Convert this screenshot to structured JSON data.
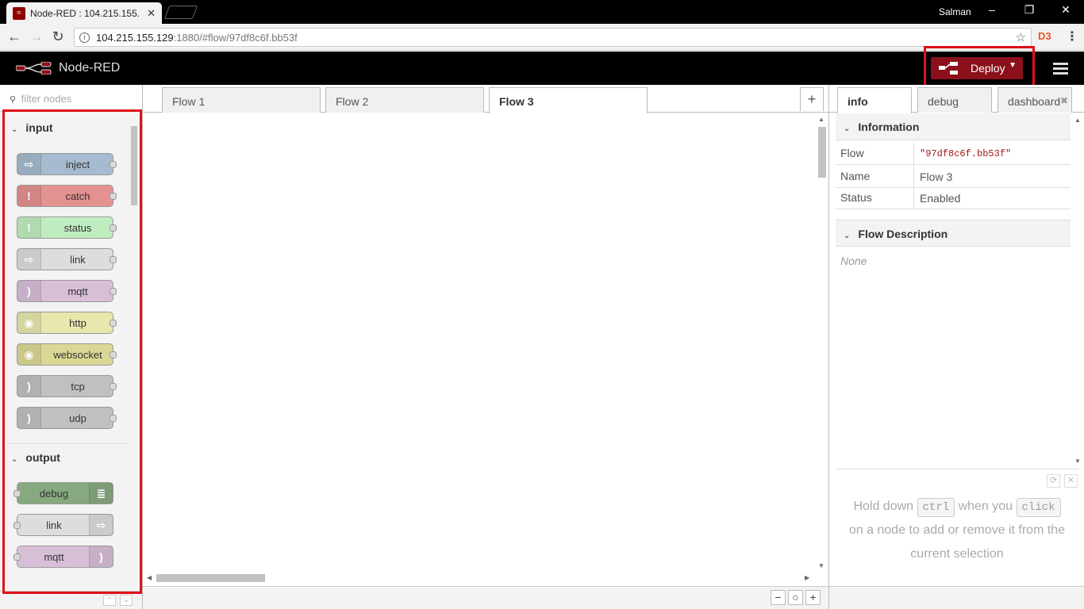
{
  "browser": {
    "tab_title": "Node-RED : 104.215.155.",
    "tab_close": "✕",
    "user": "Salman",
    "url_host": "104.215.155.129",
    "url_path": ":1880/#flow/97df8c6f.bb53f",
    "info_glyph": "i",
    "star_glyph": "☆",
    "ext_glyph": "D3",
    "menu_glyph": "⋮",
    "back_glyph": "←",
    "forward_glyph": "→",
    "reload_glyph": "↻",
    "minimize_glyph": "–",
    "restore_glyph": "❐",
    "close_glyph": "✕"
  },
  "header": {
    "title": "Node-RED",
    "deploy_label": "Deploy",
    "deploy_caret": "▼",
    "brand_color": "#8c101c"
  },
  "palette": {
    "filter_placeholder": "filter nodes",
    "filter_icon": "⚲",
    "categories": [
      {
        "name": "input",
        "chevron": "⌄",
        "nodes": [
          {
            "label": "inject",
            "color": "#a6bbcf",
            "icon": "arrow-in-icon",
            "glyph": "⇨"
          },
          {
            "label": "catch",
            "color": "#e49191",
            "icon": "alert-icon",
            "glyph": "!"
          },
          {
            "label": "status",
            "color": "#c0edc0",
            "icon": "alert-icon",
            "glyph": "!"
          },
          {
            "label": "link",
            "color": "#dddddd",
            "icon": "link-in-icon",
            "glyph": "⇨"
          },
          {
            "label": "mqtt",
            "color": "#d8bfd8",
            "icon": "bridge-icon",
            "glyph": ")"
          },
          {
            "label": "http",
            "color": "#e7e7ae",
            "icon": "globe-icon",
            "glyph": "◉"
          },
          {
            "label": "websocket",
            "color": "#dbd896",
            "icon": "globe-icon",
            "glyph": "◉"
          },
          {
            "label": "tcp",
            "color": "#c0c0c0",
            "icon": "bridge-icon",
            "glyph": ")"
          },
          {
            "label": "udp",
            "color": "#c0c0c0",
            "icon": "bridge-icon",
            "glyph": ")"
          }
        ]
      },
      {
        "name": "output",
        "chevron": "⌄",
        "nodes": [
          {
            "label": "debug",
            "color": "#87a980",
            "icon": "debug-list-icon",
            "glyph": "≣"
          },
          {
            "label": "link",
            "color": "#dddddd",
            "icon": "link-out-icon",
            "glyph": "⇨"
          },
          {
            "label": "mqtt",
            "color": "#d8bfd8",
            "icon": "bridge-icon",
            "glyph": ")"
          }
        ]
      }
    ],
    "footer_up": "⌃",
    "footer_down": "⌄"
  },
  "workspace": {
    "tabs": [
      {
        "label": "Flow 1",
        "active": false
      },
      {
        "label": "Flow 2",
        "active": false
      },
      {
        "label": "Flow 3",
        "active": true
      }
    ],
    "add_tab": "+",
    "zoom_out": "−",
    "zoom_reset": "○",
    "zoom_in": "+"
  },
  "sidebar": {
    "tabs": [
      {
        "label": "info",
        "active": true
      },
      {
        "label": "debug",
        "active": false
      },
      {
        "label": "dashboard",
        "active": false
      }
    ],
    "tab_close": "✖",
    "information_header": "Information",
    "rows": [
      {
        "key": "Flow",
        "value": "\"97df8c6f.bb53f\""
      },
      {
        "key": "Name",
        "value": "Flow 3"
      },
      {
        "key": "Status",
        "value": "Enabled"
      }
    ],
    "description_header": "Flow Description",
    "description_value": "None",
    "tip": {
      "line1_a": "Hold down",
      "key1": "ctrl",
      "line1_b": "when you",
      "key2": "click",
      "line2": "on a node to add or remove it from the",
      "line3": "current selection"
    },
    "tip_refresh": "⟳",
    "tip_close": "✕"
  }
}
